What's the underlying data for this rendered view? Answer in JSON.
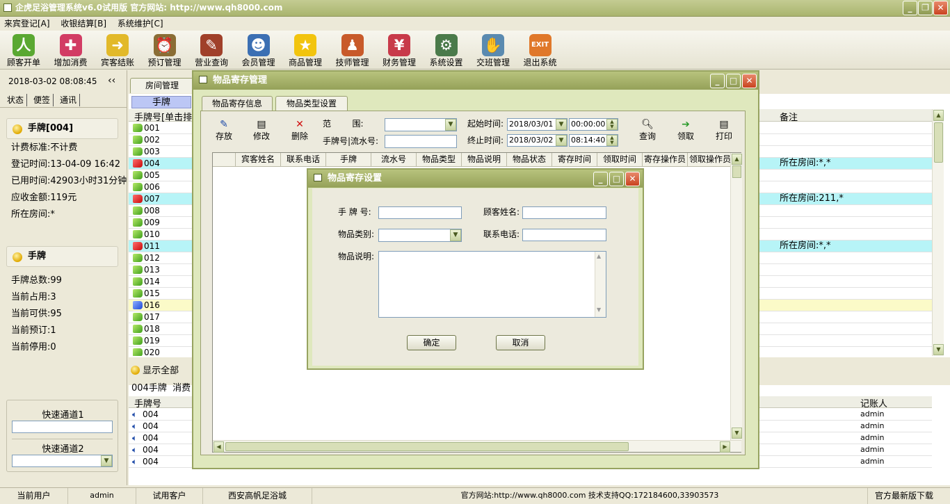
{
  "titlebar": {
    "title": "企虎足浴管理系统v6.0试用版 官方网站: http://www.qh8000.com"
  },
  "menu": [
    "来宾登记[A]",
    "收银结算[B]",
    "系统维护[C]"
  ],
  "toolbar": [
    {
      "label": "顾客开单",
      "icon": "person-icon",
      "color": "#5aa832",
      "glyph": "人"
    },
    {
      "label": "增加消费",
      "icon": "add-icon",
      "color": "#d23c64",
      "glyph": "✚"
    },
    {
      "label": "宾客结账",
      "icon": "checkout-icon",
      "color": "#e2b92a",
      "glyph": "➜"
    },
    {
      "label": "预订管理",
      "icon": "alarm-clock-icon",
      "color": "#8a6d35",
      "glyph": "⏰"
    },
    {
      "label": "营业查询",
      "icon": "report-icon",
      "color": "#a0402a",
      "glyph": "✎"
    },
    {
      "label": "会员管理",
      "icon": "members-icon",
      "color": "#3b6fb3",
      "glyph": "☻"
    },
    {
      "label": "商品管理",
      "icon": "star-icon",
      "color": "#f2c40e",
      "glyph": "★"
    },
    {
      "label": "技师管理",
      "icon": "technicians-icon",
      "color": "#c85a2a",
      "glyph": "♟"
    },
    {
      "label": "财务管理",
      "icon": "finance-icon",
      "color": "#c83a4a",
      "glyph": "¥"
    },
    {
      "label": "系统设置",
      "icon": "settings-icon",
      "color": "#4a7a4a",
      "glyph": "⚙"
    },
    {
      "label": "交班管理",
      "icon": "handshake-icon",
      "color": "#5a8ab0",
      "glyph": "✋"
    },
    {
      "label": "退出系统",
      "icon": "exit-icon",
      "color": "#e0782a",
      "glyph": "EXIT"
    }
  ],
  "left": {
    "datetime": "2018-03-02 08:08:45",
    "tabs": [
      "状态",
      "便签",
      "通讯"
    ],
    "card_header": "手牌[004]",
    "card_lines": [
      "计费标准:不计费",
      "登记时间:13-04-09 16:42",
      "已用时间:42903小时31分钟",
      "应收金额:119元",
      "所在房间:*"
    ],
    "stats_header": "手牌",
    "stats_lines": [
      "手牌总数:99",
      "当前占用:3",
      "当前可供:95",
      "当前预订:1",
      "当前停用:0"
    ],
    "quick1_label": "快速通道1",
    "quick2_label": "快速通道2"
  },
  "main": {
    "tab_room": "房间管理",
    "tab_card": "手牌",
    "col_card": "手牌号[单击排",
    "col_note": "备注",
    "rows": [
      {
        "no": "001",
        "flag": "g",
        "note": ""
      },
      {
        "no": "002",
        "flag": "g",
        "note": ""
      },
      {
        "no": "003",
        "flag": "g",
        "note": ""
      },
      {
        "no": "004",
        "flag": "r",
        "note": "所在房间:*,*",
        "hl": "cyan"
      },
      {
        "no": "005",
        "flag": "g",
        "note": ""
      },
      {
        "no": "006",
        "flag": "g",
        "note": ""
      },
      {
        "no": "007",
        "flag": "r",
        "note": "所在房间:211,*",
        "hl": "cyan"
      },
      {
        "no": "008",
        "flag": "g",
        "note": ""
      },
      {
        "no": "009",
        "flag": "g",
        "note": ""
      },
      {
        "no": "010",
        "flag": "g",
        "note": ""
      },
      {
        "no": "011",
        "flag": "r",
        "note": "所在房间:*,*",
        "hl": "cyan"
      },
      {
        "no": "012",
        "flag": "g",
        "note": ""
      },
      {
        "no": "013",
        "flag": "g",
        "note": ""
      },
      {
        "no": "014",
        "flag": "g",
        "note": ""
      },
      {
        "no": "015",
        "flag": "g",
        "note": ""
      },
      {
        "no": "016",
        "flag": "b",
        "note": "",
        "hl": "yellow"
      },
      {
        "no": "017",
        "flag": "g",
        "note": ""
      },
      {
        "no": "018",
        "flag": "g",
        "note": ""
      },
      {
        "no": "019",
        "flag": "g",
        "note": ""
      },
      {
        "no": "020",
        "flag": "g",
        "note": ""
      }
    ],
    "show_all": "显示全部",
    "detail_caption": "004手牌  消费",
    "detail_col_card": "手牌号",
    "detail_col_keeper": "记账人",
    "detail_rows": [
      {
        "no": "004",
        "keeper": "admin"
      },
      {
        "no": "004",
        "keeper": "admin"
      },
      {
        "no": "004",
        "keeper": "admin"
      },
      {
        "no": "004",
        "keeper": "admin"
      },
      {
        "no": "004",
        "keeper": "admin"
      }
    ]
  },
  "storage_dialog": {
    "title": "物品寄存管理",
    "tabs": [
      "物品寄存信息",
      "物品类型设置"
    ],
    "btn_store": "存放",
    "btn_edit": "修改",
    "btn_delete": "删除",
    "range_label": "范        围:",
    "card_serial_label": "手牌号|流水号:",
    "start_label": "起始时间:",
    "end_label": "终止时间:",
    "start_date": "2018/03/01",
    "start_time": "00:00:00",
    "end_date": "2018/03/02",
    "end_time": "08:14:40",
    "btn_query": "查询",
    "btn_receive": "领取",
    "btn_print": "打印",
    "columns": [
      "宾客姓名",
      "联系电话",
      "手牌",
      "流水号",
      "物品类型",
      "物品说明",
      "物品状态",
      "寄存时间",
      "领取时间",
      "寄存操作员",
      "领取操作员"
    ]
  },
  "settings_dialog": {
    "title": "物品寄存设置",
    "card_label": "手 牌 号:",
    "customer_label": "顾客姓名:",
    "category_label": "物品类别:",
    "phone_label": "联系电话:",
    "desc_label": "物品说明:",
    "ok": "确定",
    "cancel": "取消"
  },
  "status": {
    "user_label": "当前用户",
    "user": "admin",
    "customer": "试用客户",
    "shop": "西安高帆足浴城",
    "website": "官方网站:http://www.qh8000.com 技术支持QQ:172184600,33903573",
    "download": "官方最新版下载"
  }
}
